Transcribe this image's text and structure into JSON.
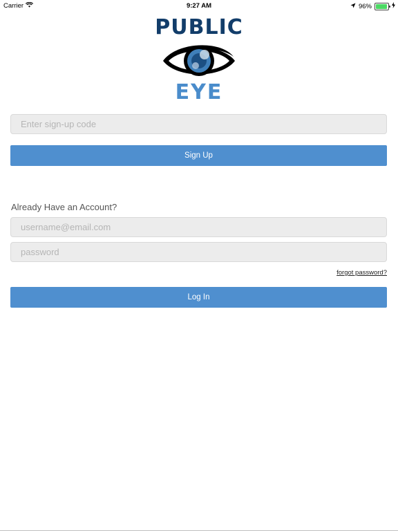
{
  "status_bar": {
    "carrier": "Carrier",
    "time": "9:27 AM",
    "battery_percent": "96%",
    "battery_level": 0.96,
    "icons": [
      "wifi-icon",
      "location-arrow-icon",
      "battery-icon",
      "charging-bolt-icon"
    ]
  },
  "logo": {
    "top_text": "PUBLIC",
    "bottom_text": "EYE",
    "primary_color": "#123d6a",
    "accent_color": "#4a8ccb"
  },
  "signup": {
    "code_placeholder": "Enter sign-up code",
    "code_value": "",
    "button_label": "Sign Up"
  },
  "login": {
    "heading": "Already Have an Account?",
    "username_placeholder": "username@email.com",
    "username_value": "",
    "password_placeholder": "password",
    "password_value": "",
    "forgot_label": "forgot password?",
    "button_label": "Log In"
  },
  "colors": {
    "button": "#4f8fcf",
    "field_background": "#ececec",
    "battery": "#4cd964"
  }
}
